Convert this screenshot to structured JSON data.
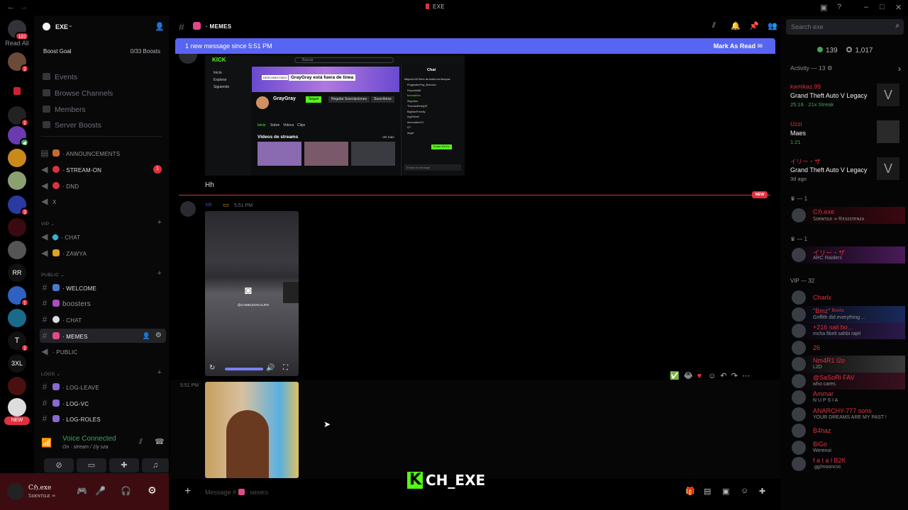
{
  "titlebar": {
    "title": "EXE"
  },
  "rail": {
    "read_all": "Read All",
    "badge_main": "101",
    "new_label": "NEW"
  },
  "server": {
    "name": "EXE",
    "boost_goal": "Boost Goal",
    "boost_count": "0/33 Boosts",
    "nav": [
      "Events",
      "Browse Channels",
      "Members",
      "Server Boosts"
    ],
    "channels": {
      "announcements": "ANNOUNCEMENTS",
      "stream_on": "STREAM-ON",
      "dnd": "DND",
      "x": "X",
      "cat_vip": "VIP",
      "chat_vip": "CHAT",
      "zawya": "ZAWYA",
      "cat_public": "PUBLIC",
      "welcome": "WELCOME",
      "boosters": "boosters",
      "chat_public": "CHAT",
      "memes": "MEMES",
      "public_voice": "PUBLIC",
      "cat_logs": "LOGS",
      "log_leave": "LOG-LEAVE",
      "log_vc": "LOG-VC",
      "log_roles": "LOG-ROLES"
    },
    "stream_badge": "1"
  },
  "voice": {
    "title": "Voice Connected",
    "sub": "On · stream / 1ly sza"
  },
  "user": {
    "name": "Cℌ.exe",
    "status": "Ꮪᴅᴇɴᴛɪʟᴇ ∞"
  },
  "chat": {
    "channel": "MEMES",
    "banner_text": "1 new message since 5:51 PM",
    "mark_read": "Mark As Read",
    "msg_hh": "Hh",
    "new_pill": "NEW",
    "author": "ᴷᴵᴷ",
    "time1": "5:51 PM",
    "time2": "5:51 PM",
    "composer_placeholder": "Message #",
    "composer_channel": "MEMES",
    "insta_handle": "@CAMELEON.CLIPS",
    "kick_watermark": "CH_EXE"
  },
  "kick_screenshot": {
    "search": "Buscar",
    "nav": [
      "Inicio",
      "Explorar",
      "Siguiendo"
    ],
    "offline_tag": "DESCONECTADO",
    "offline_text": "GrayGray está fuera de línea",
    "streamer": "GrayGray",
    "follow": "Seguir",
    "gift": "Regalar Suscripciones",
    "subscribe": "Suscribirse",
    "tabs": [
      "Inicio",
      "Sobre",
      "Videos",
      "Clips"
    ],
    "videos_title": "Videos de streams",
    "see_all": "Ver todo",
    "chat_title": "Chat",
    "chat_header": "Mejores KICKers de todos los tiempos",
    "chat_users": [
      "PragmaticPlay_Brandon",
      "Reyrolds88",
      "bonodelmo",
      "Slyyxdus",
      "ThomasReddy57",
      "BigManFrendly",
      "AyyDiesel",
      "donovaldor10",
      "G7",
      "angel"
    ],
    "send_btn": "Enviar KICKs",
    "chat_input": "Enviar un mensaje"
  },
  "members": {
    "search_placeholder": "Search exe",
    "online": "139",
    "total": "1,017",
    "activity_title": "Activity — 13",
    "activities": [
      {
        "name": "kamikaz.99",
        "game": "Grand Theft Auto V Legacy",
        "meta": "25:18 · 21x Streak"
      },
      {
        "name": "Uzzi",
        "game": "Maes",
        "meta": "1:21"
      },
      {
        "name": "イリー・ザ",
        "game": "Grand Theft Auto V Legacy",
        "meta": "3d ago"
      }
    ],
    "group1": "— 1",
    "group2": "— 1",
    "group_vip": "VIP — 32",
    "list": [
      {
        "name": "Cℌ.exe",
        "status": "Ꮪᴅᴇɴᴛɪʟᴇ ∞ Ꭱᴇꜱɪꜱᴛᴇɴᴢᴀ"
      },
      {
        "name": "イリー・ザ",
        "status": "ARC Raiders"
      },
      {
        "name": "Charlx",
        "status": ""
      },
      {
        "name": "\"Bmz\" ᴮᵒᵒᵇˢ",
        "status": "Griffith did everything ..."
      },
      {
        "name": "+216 sail bo...",
        "status": "mcha fibeli sahbi rajel"
      },
      {
        "name": "26",
        "status": ""
      },
      {
        "name": "Nm4R1 l2o",
        "status": "L2D"
      },
      {
        "name": "@SaSoRi FAV",
        "status": "who cares"
      },
      {
        "name": "Ammar",
        "status": "N U P S I A"
      },
      {
        "name": "ANARCHY-777 sons",
        "status": "YOUR DREAMS ARE MY PAST !"
      },
      {
        "name": "B4haz",
        "status": ""
      },
      {
        "name": "BiGo",
        "status": "Werenoi"
      },
      {
        "name": "f a t a l B2K",
        "status": ".gg/mooncvc"
      }
    ]
  },
  "colors": {
    "accent": "#5865f2",
    "danger": "#e03040",
    "online": "#43a25a",
    "kick_green": "#53fc18"
  }
}
